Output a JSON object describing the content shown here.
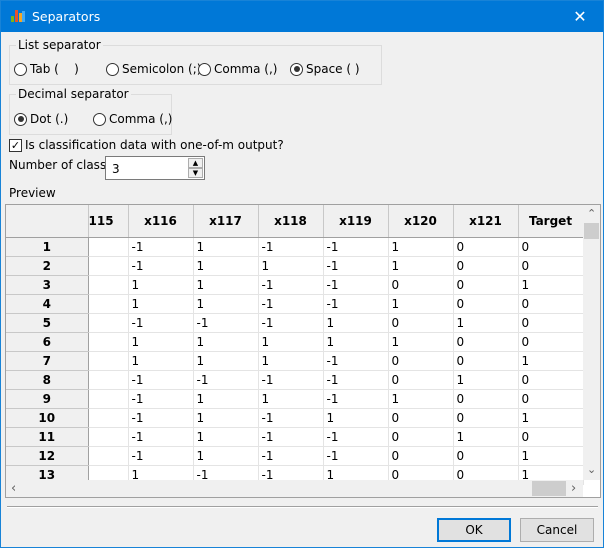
{
  "window": {
    "title": "Separators",
    "close": "✕"
  },
  "list_separator": {
    "legend": "List separator",
    "options": [
      {
        "label": "Tab (    )",
        "selected": false
      },
      {
        "label": "Semicolon (;)",
        "selected": false
      },
      {
        "label": "Comma (,)",
        "selected": false
      },
      {
        "label": "Space ( )",
        "selected": true
      }
    ]
  },
  "decimal_separator": {
    "legend": "Decimal separator",
    "options": [
      {
        "label": "Dot (.)",
        "selected": true
      },
      {
        "label": "Comma (,)",
        "selected": false
      }
    ]
  },
  "classification": {
    "label": "Is classification data with one-of-m output?",
    "checked": true
  },
  "num_classes": {
    "label": "Number of classes",
    "value": "3"
  },
  "preview": {
    "label": "Preview",
    "columns": [
      "115",
      "x116",
      "x117",
      "x118",
      "x119",
      "x120",
      "x121",
      "Target"
    ],
    "rows": [
      [
        "1",
        "",
        "-1",
        "1",
        "-1",
        "-1",
        "1",
        "0",
        "0"
      ],
      [
        "2",
        "",
        "-1",
        "1",
        "1",
        "-1",
        "1",
        "0",
        "0"
      ],
      [
        "3",
        "",
        "1",
        "1",
        "-1",
        "-1",
        "0",
        "0",
        "1"
      ],
      [
        "4",
        "",
        "1",
        "1",
        "-1",
        "-1",
        "1",
        "0",
        "0"
      ],
      [
        "5",
        "",
        "-1",
        "-1",
        "-1",
        "1",
        "0",
        "1",
        "0"
      ],
      [
        "6",
        "",
        "1",
        "1",
        "1",
        "1",
        "1",
        "0",
        "0"
      ],
      [
        "7",
        "",
        "1",
        "1",
        "1",
        "-1",
        "0",
        "0",
        "1"
      ],
      [
        "8",
        "",
        "-1",
        "-1",
        "-1",
        "-1",
        "0",
        "1",
        "0"
      ],
      [
        "9",
        "",
        "-1",
        "1",
        "1",
        "-1",
        "1",
        "0",
        "0"
      ],
      [
        "10",
        "",
        "-1",
        "1",
        "-1",
        "1",
        "0",
        "0",
        "1"
      ],
      [
        "11",
        "",
        "-1",
        "1",
        "-1",
        "-1",
        "0",
        "1",
        "0"
      ],
      [
        "12",
        "",
        "-1",
        "1",
        "-1",
        "-1",
        "0",
        "0",
        "1"
      ],
      [
        "13",
        "",
        "1",
        "-1",
        "-1",
        "1",
        "0",
        "0",
        "1"
      ]
    ]
  },
  "buttons": {
    "ok": "OK",
    "cancel": "Cancel"
  }
}
